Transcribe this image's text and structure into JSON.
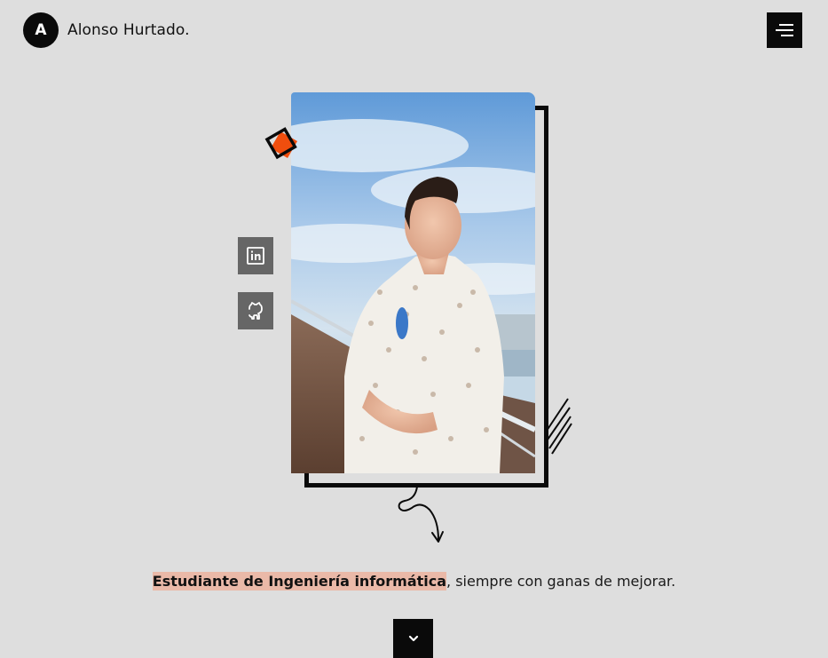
{
  "header": {
    "logo_letter": "A",
    "name": "Alonso Hurtado."
  },
  "hero": {
    "tagline_highlight": "Estudiante de Ingeniería informática",
    "tagline_rest": ", siempre con ganas de mejorar."
  },
  "social": [
    {
      "icon": "linkedin-icon"
    },
    {
      "icon": "github-icon"
    }
  ],
  "colors": {
    "background": "#dedede",
    "dark": "#0a0a0a",
    "accent_orange": "#f04e0e",
    "highlight": "#eab9a8",
    "social_bg": "#666666"
  }
}
